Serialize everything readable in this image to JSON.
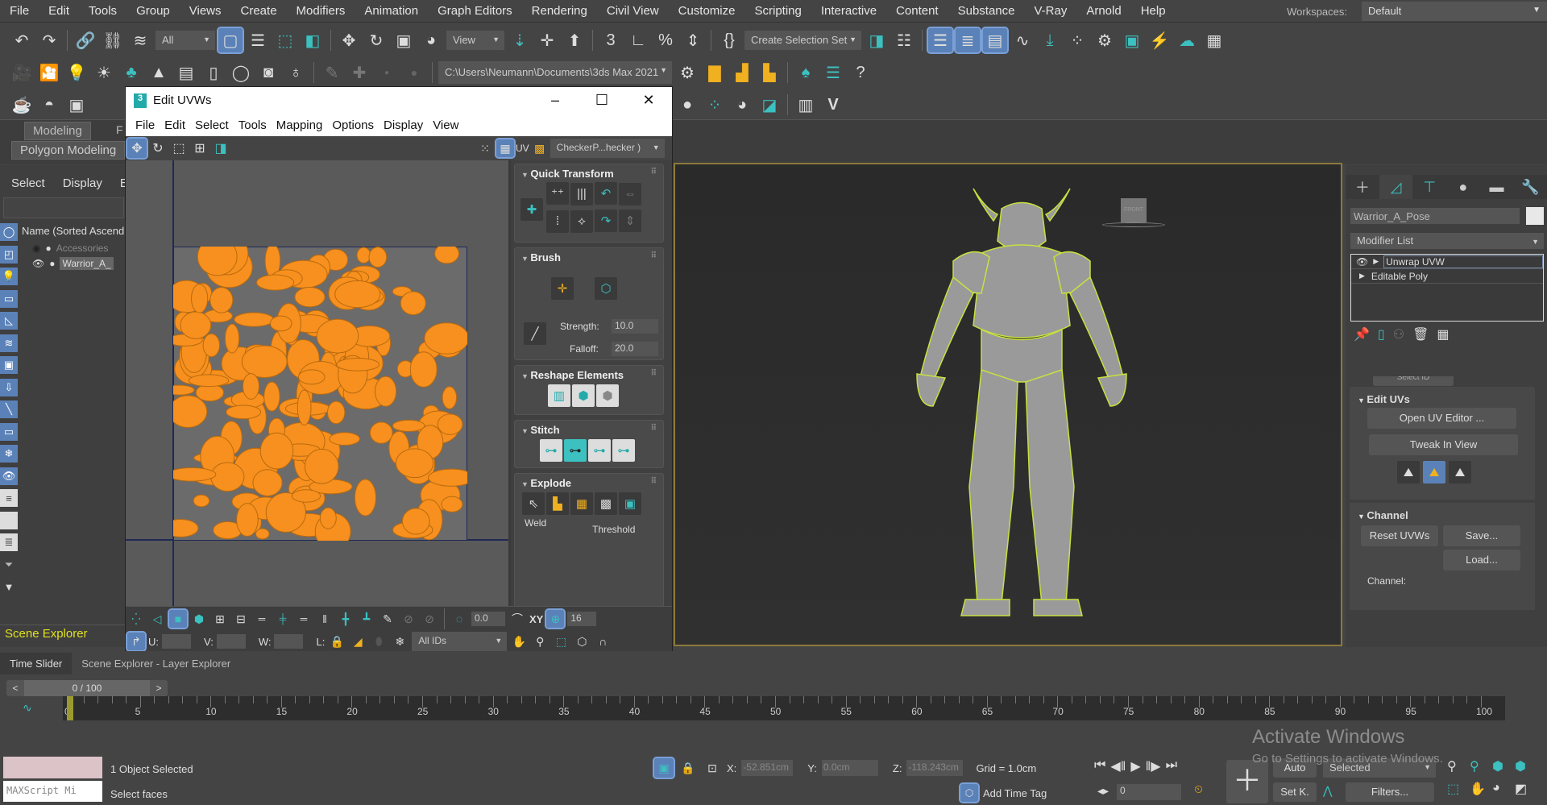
{
  "menu": [
    "File",
    "Edit",
    "Tools",
    "Group",
    "Views",
    "Create",
    "Modifiers",
    "Animation",
    "Graph Editors",
    "Rendering",
    "Civil View",
    "Customize",
    "Scripting",
    "Interactive",
    "Content",
    "Substance",
    "V-Ray",
    "Arnold",
    "Help"
  ],
  "workspaces": {
    "label": "Workspaces:",
    "value": "Default"
  },
  "toolbar": {
    "filter": "All",
    "ref_coord": "View",
    "selection_set": "Create Selection Set",
    "project_path": "C:\\Users\\Neumann\\Documents\\3ds Max 2021"
  },
  "ribbon": {
    "tab": "Modeling",
    "tab2": "F",
    "subtab": "Polygon Modeling"
  },
  "scene_explorer": {
    "tabs": [
      "Select",
      "Display",
      "E"
    ],
    "column": "Name (Sorted Ascend",
    "items": [
      {
        "name": "Accessories",
        "visible": false
      },
      {
        "name": "Warrior_A_",
        "visible": true
      }
    ],
    "footer": "Scene Explorer"
  },
  "uv_editor": {
    "title": "Edit UVWs",
    "menu": [
      "File",
      "Edit",
      "Select",
      "Tools",
      "Mapping",
      "Options",
      "Display",
      "View"
    ],
    "uv_label": "UV",
    "texture": "CheckerP...hecker )",
    "rollouts": {
      "quick_transform": "Quick Transform",
      "brush": "Brush",
      "strength_label": "Strength:",
      "strength": "10.0",
      "falloff_label": "Falloff:",
      "falloff": "20.0",
      "reshape": "Reshape Elements",
      "stitch": "Stitch",
      "explode": "Explode",
      "weld": "Weld",
      "threshold": "Threshold"
    },
    "bottom": {
      "angle": "0.0",
      "xy": "XY",
      "grid_subdiv": "16",
      "u": "U:",
      "v": "V:",
      "w": "W:",
      "l": "L:",
      "ids": "All IDs"
    },
    "colors": {
      "uv_islands": "#f7901e",
      "wire": "#c8e040"
    }
  },
  "viewport": {
    "viewcube": "FRONT",
    "accent": "#8c7a3c"
  },
  "command_panel": {
    "object_name": "Warrior_A_Pose",
    "modifier_list": "Modifier List",
    "stack": [
      "Unwrap UVW",
      "Editable Poly"
    ],
    "select_id": "Select ID",
    "edit_uvs": "Edit UVs",
    "open_uv_editor": "Open UV Editor ...",
    "tweak": "Tweak In View",
    "channel": "Channel",
    "reset": "Reset UVWs",
    "save": "Save...",
    "load": "Load...",
    "channel_label": "Channel:"
  },
  "timeline": {
    "tabs": [
      "Time Slider",
      "Scene Explorer - Layer Explorer"
    ],
    "frame": "0 / 100",
    "current": 0,
    "end": 100,
    "labels": [
      "0",
      "5",
      "10",
      "15",
      "20",
      "25",
      "30",
      "35",
      "40",
      "45",
      "50",
      "55",
      "60",
      "65",
      "70",
      "75",
      "80",
      "85",
      "90",
      "95",
      "100"
    ]
  },
  "status": {
    "maxscript": "MAXScript Mi",
    "selected": "1 Object Selected",
    "prompt": "Select faces",
    "x_label": "X:",
    "x": "-52.851cm",
    "y_label": "Y:",
    "y": "0.0cm",
    "z_label": "Z:",
    "z": "-118.243cm",
    "grid": "Grid = 1.0cm",
    "add_time_tag": "Add Time Tag",
    "frame": "0",
    "auto": "Auto",
    "setk": "Set K.",
    "key_filter": "Selected",
    "filters": "Filters..."
  },
  "watermark": {
    "line1": "Activate Windows",
    "line2": "Go to Settings to activate Windows."
  }
}
